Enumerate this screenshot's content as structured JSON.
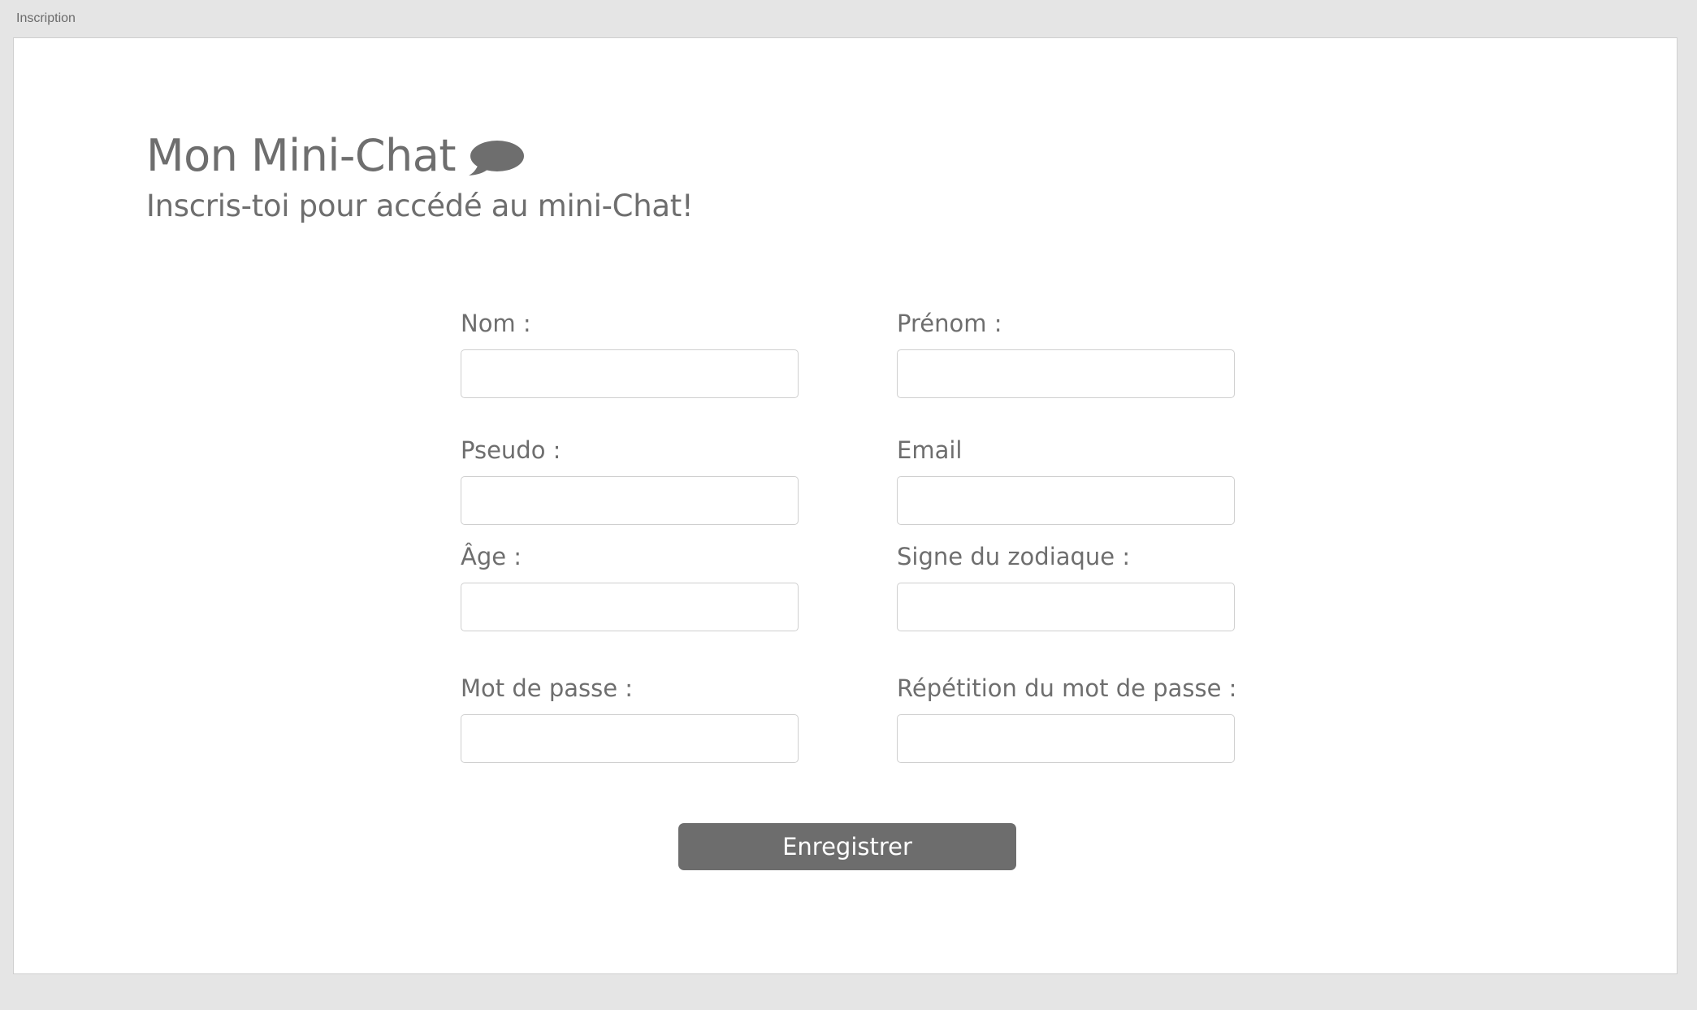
{
  "window": {
    "title": "Inscription"
  },
  "header": {
    "title": "Mon Mini-Chat",
    "icon": "speech-bubble-icon",
    "subtitle": "Inscris-toi pour accédé au mini-Chat!"
  },
  "form": {
    "fields": {
      "nom": {
        "label": "Nom :",
        "value": ""
      },
      "prenom": {
        "label": "Prénom :",
        "value": ""
      },
      "pseudo": {
        "label": "Pseudo :",
        "value": ""
      },
      "email": {
        "label": "Email",
        "value": ""
      },
      "age": {
        "label": "Âge :",
        "value": ""
      },
      "zodiaque": {
        "label": "Signe du zodiaque :",
        "value": ""
      },
      "password": {
        "label": "Mot de passe :",
        "value": ""
      },
      "password_repeat": {
        "label": "Répétition du mot de passe :",
        "value": ""
      }
    },
    "submit_label": "Enregistrer"
  },
  "colors": {
    "page_background": "#e5e5e5",
    "text": "#6e6e6e",
    "button_background": "#6d6d6d",
    "button_text": "#ffffff",
    "input_border": "#cfcfcf"
  }
}
